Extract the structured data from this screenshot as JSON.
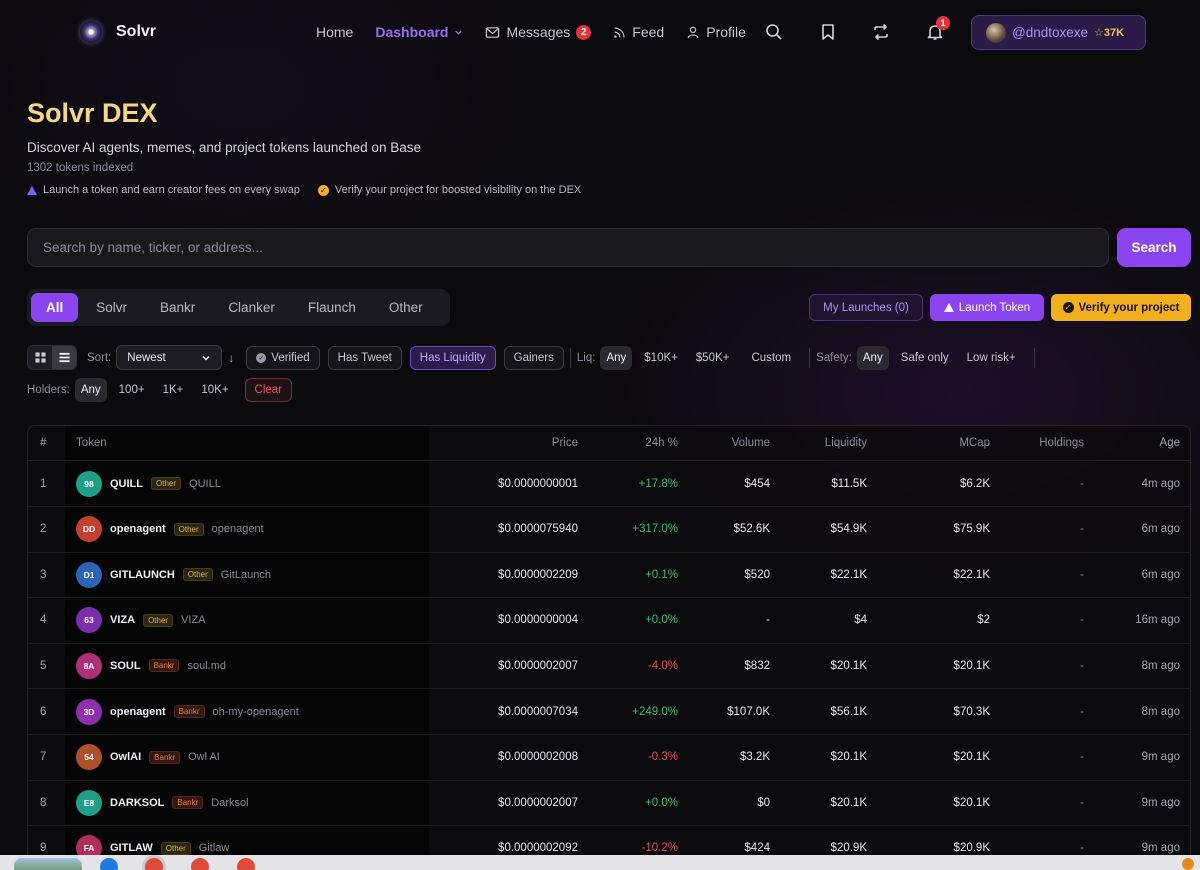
{
  "nav": {
    "brand": "Solvr",
    "links": [
      {
        "label": "Home"
      },
      {
        "label": "Dashboard"
      },
      {
        "label": "Messages",
        "badge": "2"
      },
      {
        "label": "Feed"
      },
      {
        "label": "Profile"
      }
    ],
    "notifications_badge": "1",
    "user": {
      "handle": "@dndtoxexe",
      "stars": "37K"
    }
  },
  "hero": {
    "title": "Solvr DEX",
    "subtitle": "Discover AI agents, memes, and project tokens launched on Base",
    "count": "1302 tokens indexed",
    "tip1": "Launch a token and earn creator fees on every swap",
    "tip2": "Verify your project for boosted visibility on the DEX"
  },
  "search": {
    "placeholder": "Search by name, ticker, or address...",
    "button": "Search"
  },
  "tabs": [
    "All",
    "Solvr",
    "Bankr",
    "Clanker",
    "Flaunch",
    "Other"
  ],
  "actions": {
    "my_launches": "My Launches (0)",
    "launch_token": "Launch Token",
    "verify": "Verify your project"
  },
  "filters": {
    "sort_label": "Sort:",
    "sort_value": "Newest",
    "verified": "Verified",
    "has_tweet": "Has Tweet",
    "has_liquidity": "Has Liquidity",
    "gainers": "Gainers",
    "liq_label": "Liq:",
    "liq_options": [
      "Any",
      "$10K+",
      "$50K+",
      "Custom"
    ],
    "safety_label": "Safety:",
    "safety_options": [
      "Any",
      "Safe only",
      "Low risk+"
    ],
    "holders_label": "Holders:",
    "holders_options": [
      "Any",
      "100+",
      "1K+",
      "10K+"
    ],
    "clear": "Clear"
  },
  "table": {
    "headers": {
      "idx": "#",
      "token": "Token",
      "price": "Price",
      "change": "24h %",
      "volume": "Volume",
      "liquidity": "Liquidity",
      "mcap": "MCap",
      "holdings": "Holdings",
      "age": "Age"
    },
    "rows": [
      {
        "idx": "1",
        "av": "98",
        "color": "#1f9e8a",
        "sym": "QUILL",
        "plat": "Other",
        "name": "QUILL",
        "price": "$0.0000000001",
        "chg": "+17.8%",
        "dir": "pos",
        "vol": "$454",
        "liq": "$11.5K",
        "mcap": "$6.2K",
        "hold": "-",
        "age": "4m ago"
      },
      {
        "idx": "2",
        "av": "DD",
        "color": "#c2402f",
        "sym": "openagent",
        "plat": "Other",
        "name": "openagent",
        "price": "$0.0000075940",
        "chg": "+317.0%",
        "dir": "pos",
        "vol": "$52.6K",
        "liq": "$54.9K",
        "mcap": "$75.9K",
        "hold": "-",
        "age": "6m ago"
      },
      {
        "idx": "3",
        "av": "D1",
        "color": "#2a63b8",
        "sym": "GITLAUNCH",
        "plat": "Other",
        "name": "GitLaunch",
        "price": "$0.0000002209",
        "chg": "+0.1%",
        "dir": "pos",
        "vol": "$520",
        "liq": "$22.1K",
        "mcap": "$22.1K",
        "hold": "-",
        "age": "6m ago"
      },
      {
        "idx": "4",
        "av": "63",
        "color": "#7a2fb0",
        "sym": "VIZA",
        "plat": "Other",
        "name": "VIZA",
        "price": "$0.0000000004",
        "chg": "+0.0%",
        "dir": "pos",
        "vol": "-",
        "liq": "$4",
        "mcap": "$2",
        "hold": "-",
        "age": "16m ago"
      },
      {
        "idx": "5",
        "av": "8A",
        "color": "#b02f7a",
        "sym": "SOUL",
        "plat": "Bankr",
        "name": "soul.md",
        "price": "$0.0000002007",
        "chg": "-4.0%",
        "dir": "neg",
        "vol": "$832",
        "liq": "$20.1K",
        "mcap": "$20.1K",
        "hold": "-",
        "age": "8m ago"
      },
      {
        "idx": "6",
        "av": "3D",
        "color": "#8e2fb0",
        "sym": "openagent",
        "plat": "Bankr",
        "name": "oh-my-openagent",
        "price": "$0.0000007034",
        "chg": "+249.0%",
        "dir": "pos",
        "vol": "$107.0K",
        "liq": "$56.1K",
        "mcap": "$70.3K",
        "hold": "-",
        "age": "8m ago"
      },
      {
        "idx": "7",
        "av": "54",
        "color": "#b0502a",
        "sym": "OwlAI",
        "plat": "Bankr",
        "name": "Owl AI",
        "price": "$0.0000002008",
        "chg": "-0.3%",
        "dir": "neg",
        "vol": "$3.2K",
        "liq": "$20.1K",
        "mcap": "$20.1K",
        "hold": "-",
        "age": "9m ago"
      },
      {
        "idx": "8",
        "av": "E8",
        "color": "#1f9e8a",
        "sym": "DARKSOL",
        "plat": "Bankr",
        "name": "Darksol",
        "price": "$0.0000002007",
        "chg": "+0.0%",
        "dir": "pos",
        "vol": "$0",
        "liq": "$20.1K",
        "mcap": "$20.1K",
        "hold": "-",
        "age": "9m ago"
      },
      {
        "idx": "9",
        "av": "FA",
        "color": "#b02f5a",
        "sym": "GITLAW",
        "plat": "Other",
        "name": "Gitlaw",
        "price": "$0.0000002092",
        "chg": "-10.2%",
        "dir": "neg",
        "vol": "$424",
        "liq": "$20.9K",
        "mcap": "$20.9K",
        "hold": "-",
        "age": "9m ago"
      }
    ]
  }
}
